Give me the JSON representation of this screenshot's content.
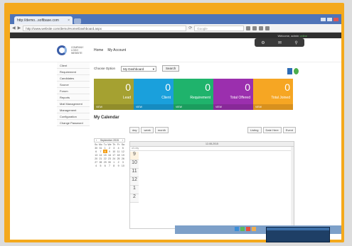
{
  "browser": {
    "tab_title": "http://demo...softbase.com",
    "tab_close": "×",
    "url": "http://www.website.com/demo/Home/Dashboard.aspx",
    "search_placeholder": "Google",
    "nav_back": "◀",
    "nav_forward": "▶",
    "nav_reload": "⟳"
  },
  "welcome": {
    "text": "Welcome, admin",
    "status": "online"
  },
  "header": {
    "logo_text": "COMPANY LOGO WEBSITE",
    "nav": [
      "Home",
      "My Account"
    ]
  },
  "toolbar_icons": [
    "⚙",
    "✉",
    "⚲"
  ],
  "sidebar": {
    "items": [
      "Client",
      "Requirement",
      "Candidates",
      "Source",
      "Forum",
      "Reports",
      "Mail Management",
      "Management",
      "Configuration",
      "Change Password"
    ]
  },
  "filter": {
    "label": "Choose Option",
    "select_value": "My Dashboard",
    "button": "Search"
  },
  "cards": [
    {
      "value": "0",
      "title": "Lead",
      "foot": "VIEW",
      "color": "#a5a131"
    },
    {
      "value": "0",
      "title": "Client",
      "foot": "VIEW",
      "color": "#1aa0dc"
    },
    {
      "value": "0",
      "title": "Requirement",
      "foot": "VIEW",
      "color": "#1fb36c"
    },
    {
      "value": "0",
      "title": "Total Offered",
      "foot": "VIEW",
      "color": "#9b2fae"
    },
    {
      "value": "0",
      "title": "Total Joined",
      "foot": "VIEW",
      "color": "#f6a623"
    }
  ],
  "calendar": {
    "title": "My Calendar",
    "mini_header": "September 2015",
    "weekdays": [
      "Su",
      "Mo",
      "Tu",
      "We",
      "Th",
      "Fr",
      "Sa"
    ],
    "weeks": [
      [
        "30",
        "31",
        "1",
        "2",
        "3",
        "4",
        "5"
      ],
      [
        "6",
        "7",
        "8",
        "9",
        "10",
        "11",
        "12"
      ],
      [
        "13",
        "14",
        "15",
        "16",
        "17",
        "18",
        "19"
      ],
      [
        "20",
        "21",
        "22",
        "23",
        "24",
        "25",
        "26"
      ],
      [
        "27",
        "28",
        "29",
        "30",
        "1",
        "2",
        "3"
      ],
      [
        "4",
        "5",
        "6",
        "7",
        "8",
        "9",
        "10"
      ]
    ],
    "today": "8",
    "views_left": [
      "day",
      "week",
      "month"
    ],
    "views_right": [
      "Listing",
      "Date Here",
      "Event"
    ],
    "day_header": "12-08-2015",
    "all_day": "all-day",
    "hours": [
      "9",
      "10",
      "11",
      "12",
      "1",
      "2"
    ]
  }
}
